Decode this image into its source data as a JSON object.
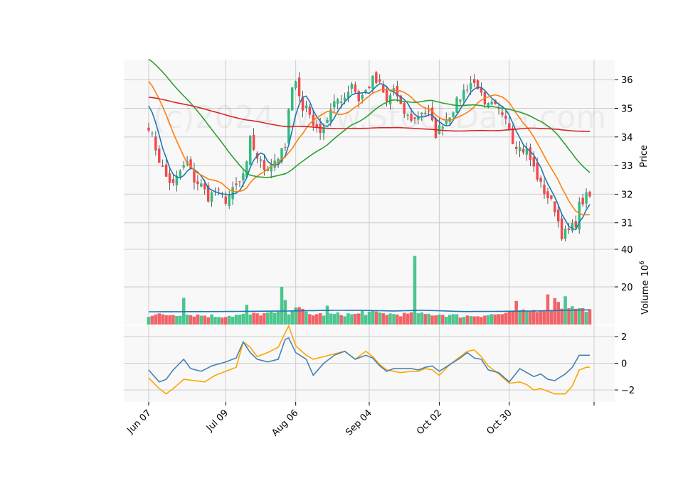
{
  "chart_data": {
    "type": "candlestick",
    "watermark": "(c)2024 www.StockData.com",
    "x_tick_labels": [
      "Jun 07",
      "Jul 09",
      "Aug 06",
      "Sep 04",
      "Oct 02",
      "Oct 30"
    ],
    "x_tick_indices": [
      0,
      22,
      42,
      63,
      83,
      103
    ],
    "n_bars": 127,
    "colors": {
      "up": "#2ebc7c",
      "down": "#f0494d",
      "sma_short": "#1f77b4",
      "sma_mid": "#ff7f0e",
      "sma_long": "#2ca02c",
      "sma_xlong": "#d62728",
      "osc_a": "#4682b4",
      "osc_b": "#ffa500",
      "panel_bg": "#f8f8f8",
      "grid": "#cccccc"
    },
    "price_panel": {
      "ylabel": "Price",
      "yticks": [
        31,
        32,
        33,
        34,
        35,
        36
      ],
      "ylim": [
        30.1,
        36.7
      ]
    },
    "volume_panel": {
      "ylabel": "Volume",
      "ylabel_exponent": "10",
      "ylabel_power": "6",
      "yticks": [
        20,
        40
      ],
      "ylim": [
        0,
        40
      ]
    },
    "oscillator_panel": {
      "yticks": [
        -2,
        0,
        2
      ],
      "ylim": [
        -2.9,
        2.8
      ]
    },
    "price_anchors": [
      [
        0,
        34.4
      ],
      [
        3,
        33.2
      ],
      [
        5,
        32.6
      ],
      [
        7,
        32.3
      ],
      [
        9,
        32.8
      ],
      [
        11,
        33.1
      ],
      [
        13,
        32.5
      ],
      [
        15,
        32.3
      ],
      [
        17,
        31.9
      ],
      [
        19,
        32.1
      ],
      [
        21,
        31.9
      ],
      [
        22,
        31.8
      ],
      [
        24,
        32.1
      ],
      [
        26,
        32.4
      ],
      [
        28,
        33
      ],
      [
        29,
        33.9
      ],
      [
        31,
        33.3
      ],
      [
        33,
        32.9
      ],
      [
        35,
        33.1
      ],
      [
        37,
        33.3
      ],
      [
        39,
        33.6
      ],
      [
        40,
        34.9
      ],
      [
        41,
        35.6
      ],
      [
        42,
        36.1
      ],
      [
        44,
        34.9
      ],
      [
        45,
        35.1
      ],
      [
        46,
        34.8
      ],
      [
        48,
        34.2
      ],
      [
        50,
        34.4
      ],
      [
        52,
        34.9
      ],
      [
        54,
        35.3
      ],
      [
        56,
        35.4
      ],
      [
        58,
        35.9
      ],
      [
        60,
        35.3
      ],
      [
        62,
        35.6
      ],
      [
        64,
        36
      ],
      [
        66,
        35.8
      ],
      [
        68,
        35.2
      ],
      [
        70,
        35.7
      ],
      [
        72,
        35
      ],
      [
        74,
        34.7
      ],
      [
        76,
        34.6
      ],
      [
        78,
        34.9
      ],
      [
        80,
        34.8
      ],
      [
        82,
        34.1
      ],
      [
        84,
        34.5
      ],
      [
        86,
        34.8
      ],
      [
        88,
        35.2
      ],
      [
        90,
        35.6
      ],
      [
        92,
        35.9
      ],
      [
        94,
        35.8
      ],
      [
        96,
        35
      ],
      [
        98,
        35.1
      ],
      [
        100,
        34.9
      ],
      [
        102,
        34.8
      ],
      [
        104,
        33.9
      ],
      [
        106,
        33.6
      ],
      [
        108,
        33.5
      ],
      [
        110,
        32.9
      ],
      [
        112,
        32.3
      ],
      [
        114,
        31.9
      ],
      [
        116,
        31.5
      ],
      [
        118,
        30.6
      ],
      [
        120,
        30.7
      ],
      [
        122,
        31
      ],
      [
        123,
        31.6
      ],
      [
        125,
        31.9
      ],
      [
        126,
        31.9
      ]
    ],
    "volume_anchors": [
      [
        0,
        4.5
      ],
      [
        10,
        5
      ],
      [
        20,
        4
      ],
      [
        30,
        5
      ],
      [
        40,
        6
      ],
      [
        42,
        9
      ],
      [
        46,
        5
      ],
      [
        50,
        5
      ],
      [
        60,
        5
      ],
      [
        63,
        6
      ],
      [
        70,
        5
      ],
      [
        76,
        5
      ],
      [
        78,
        5
      ],
      [
        83,
        5
      ],
      [
        90,
        4
      ],
      [
        100,
        5
      ],
      [
        104,
        6
      ],
      [
        110,
        7
      ],
      [
        115,
        8
      ],
      [
        120,
        9
      ],
      [
        126,
        7
      ]
    ],
    "volume_spikes": [
      [
        10,
        14.2
      ],
      [
        28,
        10.5
      ],
      [
        38,
        20
      ],
      [
        39,
        13
      ],
      [
        51,
        10
      ],
      [
        61,
        7.5
      ],
      [
        76,
        36.5
      ],
      [
        105,
        12.5
      ],
      [
        114,
        16
      ],
      [
        116,
        14
      ],
      [
        117,
        12
      ],
      [
        119,
        15
      ]
    ],
    "volume_ma_anchors": [
      [
        0,
        6.8
      ],
      [
        20,
        6.9
      ],
      [
        40,
        7.2
      ],
      [
        50,
        7.5
      ],
      [
        60,
        7.6
      ],
      [
        70,
        7.2
      ],
      [
        78,
        7.6
      ],
      [
        90,
        6.9
      ],
      [
        100,
        7
      ],
      [
        110,
        7.2
      ],
      [
        120,
        7.6
      ],
      [
        126,
        7.8
      ]
    ],
    "osc_a_anchors": [
      [
        0,
        -0.5
      ],
      [
        3,
        -1.4
      ],
      [
        5,
        -1.2
      ],
      [
        7,
        -0.5
      ],
      [
        10,
        0.3
      ],
      [
        12,
        -0.4
      ],
      [
        15,
        -0.6
      ],
      [
        18,
        -0.2
      ],
      [
        22,
        0.1
      ],
      [
        25,
        0.4
      ],
      [
        27,
        1.6
      ],
      [
        29,
        0.8
      ],
      [
        31,
        0.3
      ],
      [
        34,
        0.1
      ],
      [
        37,
        0.3
      ],
      [
        39,
        1.8
      ],
      [
        40,
        1.9
      ],
      [
        42,
        0.8
      ],
      [
        45,
        0.3
      ],
      [
        47,
        -0.9
      ],
      [
        50,
        0
      ],
      [
        53,
        0.6
      ],
      [
        56,
        0.9
      ],
      [
        59,
        0.3
      ],
      [
        62,
        0.6
      ],
      [
        64,
        0.4
      ],
      [
        66,
        -0.2
      ],
      [
        68,
        -0.6
      ],
      [
        70,
        -0.4
      ],
      [
        72,
        -0.4
      ],
      [
        75,
        -0.4
      ],
      [
        77,
        -0.5
      ],
      [
        79,
        -0.3
      ],
      [
        81,
        -0.2
      ],
      [
        83,
        -0.6
      ],
      [
        86,
        -0.1
      ],
      [
        89,
        0.4
      ],
      [
        91,
        0.8
      ],
      [
        93,
        0.4
      ],
      [
        95,
        0.3
      ],
      [
        97,
        -0.5
      ],
      [
        100,
        -0.7
      ],
      [
        103,
        -1.4
      ],
      [
        106,
        -0.4
      ],
      [
        108,
        -0.7
      ],
      [
        110,
        -1
      ],
      [
        112,
        -0.8
      ],
      [
        114,
        -1.2
      ],
      [
        116,
        -1.3
      ],
      [
        119,
        -0.8
      ],
      [
        121,
        -0.3
      ],
      [
        123,
        0.6
      ],
      [
        125,
        0.6
      ]
    ],
    "osc_b_anchors": [
      [
        0,
        -1.1
      ],
      [
        3,
        -1.9
      ],
      [
        5,
        -2.3
      ],
      [
        7,
        -1.9
      ],
      [
        10,
        -1.2
      ],
      [
        13,
        -1.3
      ],
      [
        16,
        -1.4
      ],
      [
        19,
        -0.9
      ],
      [
        22,
        -0.6
      ],
      [
        25,
        -0.3
      ],
      [
        27,
        1.6
      ],
      [
        29,
        1.2
      ],
      [
        31,
        0.5
      ],
      [
        34,
        0.8
      ],
      [
        37,
        1.2
      ],
      [
        39,
        2.3
      ],
      [
        40,
        2.8
      ],
      [
        42,
        1.3
      ],
      [
        45,
        0.6
      ],
      [
        47,
        0.3
      ],
      [
        50,
        0.5
      ],
      [
        53,
        0.7
      ],
      [
        56,
        0.9
      ],
      [
        59,
        0.3
      ],
      [
        62,
        0.9
      ],
      [
        64,
        0.5
      ],
      [
        66,
        -0.1
      ],
      [
        68,
        -0.5
      ],
      [
        70,
        -0.6
      ],
      [
        72,
        -0.7
      ],
      [
        75,
        -0.6
      ],
      [
        77,
        -0.6
      ],
      [
        79,
        -0.4
      ],
      [
        81,
        -0.5
      ],
      [
        83,
        -0.9
      ],
      [
        86,
        -0.1
      ],
      [
        89,
        0.5
      ],
      [
        91,
        0.9
      ],
      [
        93,
        1
      ],
      [
        95,
        0.5
      ],
      [
        97,
        -0.2
      ],
      [
        100,
        -0.8
      ],
      [
        103,
        -1.5
      ],
      [
        106,
        -1.4
      ],
      [
        108,
        -1.6
      ],
      [
        110,
        -2
      ],
      [
        112,
        -1.9
      ],
      [
        114,
        -2.1
      ],
      [
        116,
        -2.3
      ],
      [
        119,
        -2.3
      ],
      [
        121,
        -1.7
      ],
      [
        123,
        -0.5
      ],
      [
        125,
        -0.3
      ]
    ]
  }
}
